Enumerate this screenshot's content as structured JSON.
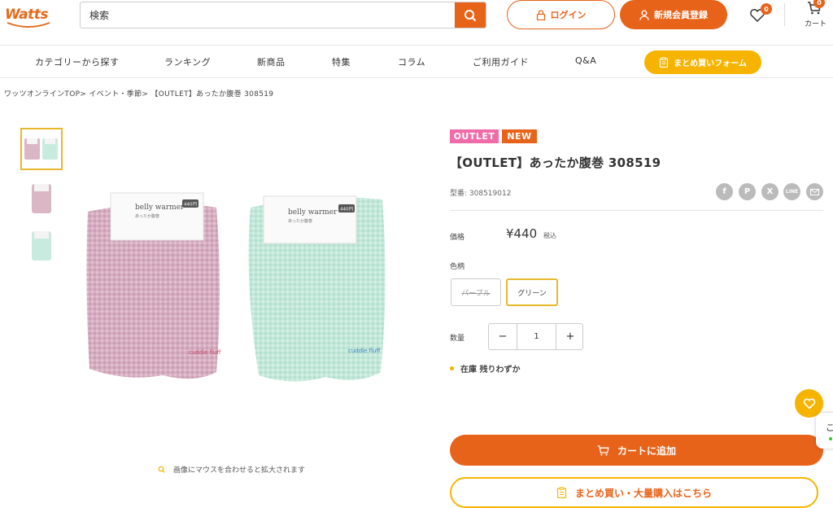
{
  "header": {
    "logo_text": "Watts",
    "search": {
      "placeholder": "検索",
      "value": "検索"
    },
    "login_label": "ログイン",
    "register_label": "新規会員登録",
    "favorites_count": "0",
    "cart_count": "0",
    "cart_label": "カート"
  },
  "nav": {
    "items": [
      "カテゴリーから探す",
      "ランキング",
      "新商品",
      "特集",
      "コラム",
      "ご利用ガイド",
      "Q&A"
    ],
    "bulk_form_label": "まとめ買いフォーム"
  },
  "breadcrumb": "ワッツオンラインTOP>  イベント・季節>  【OUTLET】あったか腹巻 308519",
  "gallery": {
    "zoom_hint": "画像にマウスを合わせると拡大されます",
    "package_text": "belly warmer",
    "package_subtext": "あったか腹巻",
    "price_sticker": "440円",
    "embroidery": "cuddle fluff"
  },
  "product": {
    "tags": [
      "OUTLET",
      "NEW"
    ],
    "title": "【OUTLET】あったか腹巻 308519",
    "model_label": "型番",
    "model_number": "型番: 308519012",
    "price_label": "価格",
    "price": "¥440",
    "tax_label": "税込",
    "color_label": "色柄",
    "variants": [
      {
        "label": "パープル",
        "state": "sold-out"
      },
      {
        "label": "グリーン",
        "state": "selected"
      }
    ],
    "quantity_label": "数量",
    "quantity": "1",
    "stock_text": "在庫 残りわずか",
    "add_to_cart_label": "カートに追加",
    "bulk_buy_label": "まとめ買い・大量購入はこちら"
  },
  "share_icons": [
    "facebook-icon",
    "pinterest-icon",
    "x-icon",
    "line-icon",
    "mail-icon"
  ],
  "side_tab_text": "こ",
  "colors": {
    "accent_orange": "#e8631a",
    "accent_yellow": "#f6b400",
    "outlet_tag": "#ef6ca8",
    "new_tag": "#e8631a",
    "selected_border": "#e6b82a"
  }
}
